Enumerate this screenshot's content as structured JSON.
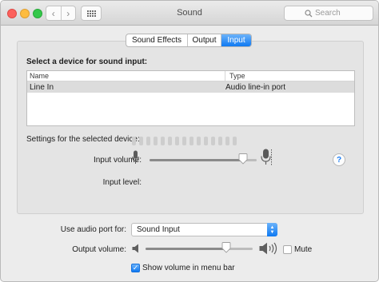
{
  "window": {
    "title": "Sound",
    "search_placeholder": "Search",
    "nav_back": "‹",
    "nav_forward": "›"
  },
  "tabs": [
    {
      "label": "Sound Effects",
      "selected": false
    },
    {
      "label": "Output",
      "selected": false
    },
    {
      "label": "Input",
      "selected": true
    }
  ],
  "input": {
    "heading": "Select a device for sound input:",
    "columns": {
      "name": "Name",
      "type": "Type"
    },
    "devices": [
      {
        "name": "Line In",
        "type": "Audio line-in port",
        "selected": true
      }
    ],
    "settings_heading": "Settings for the selected device:",
    "input_volume_label": "Input volume:",
    "input_volume_level": 0.87,
    "input_level_label": "Input level:",
    "input_level_segments": 15,
    "input_level_active": 0,
    "help": "?"
  },
  "bottom": {
    "audio_port_label": "Use audio port for:",
    "audio_port_value": "Sound Input",
    "output_volume_label": "Output volume:",
    "output_volume_level": 0.75,
    "mute_label": "Mute",
    "mute_checked": false,
    "show_volume_label": "Show volume in menu bar",
    "show_volume_checked": true
  },
  "colors": {
    "accent": "#0e79f2",
    "close": "#fc605c",
    "minimize": "#fdbc40",
    "maximize": "#34c84a"
  }
}
